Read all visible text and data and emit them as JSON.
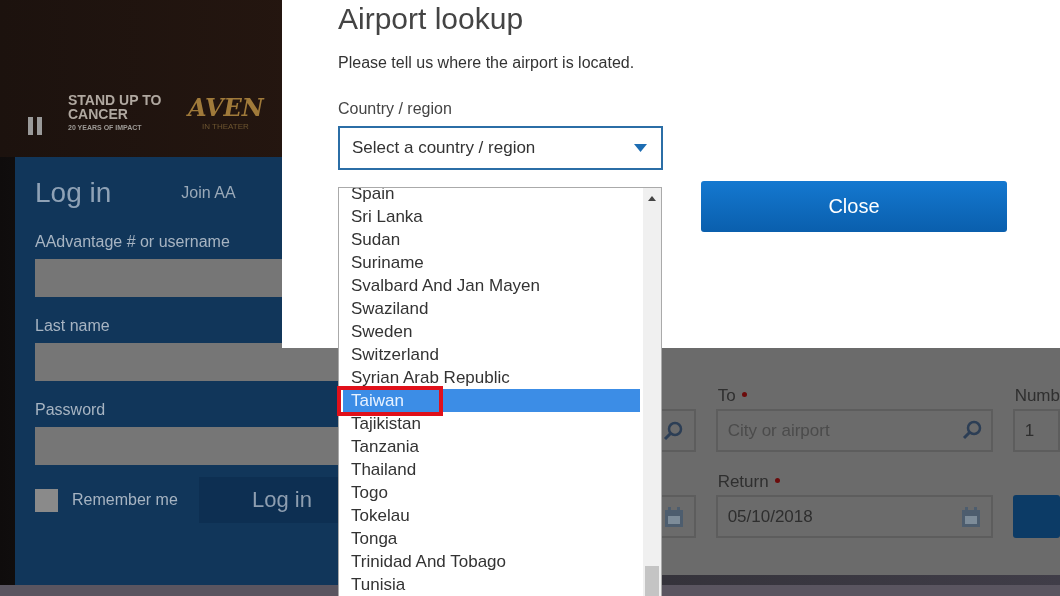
{
  "banner": {
    "logos": [
      {
        "kind": "suc",
        "lines": [
          "STAND UP TO CANCER",
          "20 YEARS OF IMPACT"
        ]
      },
      {
        "kind": "movie",
        "lines": [
          "AVEN",
          "IN THEATER"
        ]
      }
    ]
  },
  "login": {
    "title": "Log in",
    "join_link": "Join AA",
    "fields": [
      {
        "label": "AAdvantage # or username"
      },
      {
        "label": "Last name"
      },
      {
        "label": "Password"
      }
    ],
    "remember": {
      "label": "Remember me",
      "checked": false
    },
    "button": "Log in"
  },
  "booking": {
    "to": {
      "label": "To",
      "placeholder": "City or airport"
    },
    "number": {
      "label": "Numb",
      "value": "1"
    },
    "return": {
      "label": "Return",
      "value": "05/10/2018"
    }
  },
  "dialog": {
    "title": "Airport lookup",
    "prompt": "Please tell us where the airport is located.",
    "select_label": "Country / region",
    "select_value": "Select a country / region",
    "close_button": "Close"
  },
  "country_list": [
    {
      "name": "Spain",
      "selected": false
    },
    {
      "name": "Sri Lanka",
      "selected": false
    },
    {
      "name": "Sudan",
      "selected": false
    },
    {
      "name": "Suriname",
      "selected": false
    },
    {
      "name": "Svalbard And Jan Mayen",
      "selected": false
    },
    {
      "name": "Swaziland",
      "selected": false
    },
    {
      "name": "Sweden",
      "selected": false
    },
    {
      "name": "Switzerland",
      "selected": false
    },
    {
      "name": "Syrian Arab Republic",
      "selected": false
    },
    {
      "name": "Taiwan",
      "selected": true
    },
    {
      "name": "Tajikistan",
      "selected": false
    },
    {
      "name": "Tanzania",
      "selected": false
    },
    {
      "name": "Thailand",
      "selected": false
    },
    {
      "name": "Togo",
      "selected": false
    },
    {
      "name": "Tokelau",
      "selected": false
    },
    {
      "name": "Tonga",
      "selected": false
    },
    {
      "name": "Trinidad And Tobago",
      "selected": false
    },
    {
      "name": "Tunisia",
      "selected": false
    }
  ]
}
